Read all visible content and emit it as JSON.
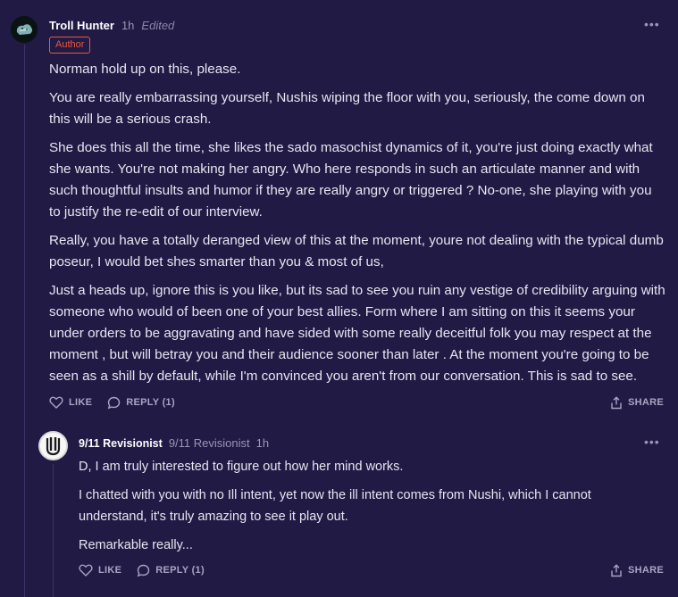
{
  "comment": {
    "author": "Troll Hunter",
    "time": "1h",
    "edited": "Edited",
    "badge": "Author",
    "paragraphs": [
      "Norman hold up on this, please.",
      "You are really embarrassing yourself, Nushis wiping the floor with you, seriously, the come down on this will be a serious crash.",
      "She does this all the time, she likes the sado masochist dynamics of it, you're just doing exactly what she wants. You're not making her angry. Who here responds in such an articulate manner and with such thoughtful insults and humor if they are really angry or triggered ? No-one, she playing with you to justify the re-edit of our interview.",
      "Really, you have a totally deranged view of this at the moment, youre not dealing with the typical dumb poseur, I would bet shes smarter than you & most of us,",
      "Just a heads up, ignore this is you like, but its sad to see you ruin any vestige of credibility arguing with someone who would of been one of your best allies. Form where I am sitting on this it seems your under orders to be aggravating and have sided with some really deceitful folk you may respect at the moment , but will betray you and their audience sooner than later . At the moment you're going to be seen as a shill by default, while I'm convinced you aren't from our conversation. This is sad to see."
    ],
    "like_label": "LIKE",
    "reply_label": "REPLY (1)",
    "share_label": "SHARE",
    "more_icon": "more-horizontal-icon"
  },
  "reply": {
    "author": "9/11 Revisionist",
    "handle": "9/11 Revisionist",
    "time": "1h",
    "paragraphs": [
      "D, I am truly interested to figure out how her mind works.",
      "I chatted with you with no Ill intent, yet now the ill intent comes from Nushi, which I cannot understand, it's truly amazing to see it play out.",
      "Remarkable really..."
    ],
    "like_label": "LIKE",
    "reply_label": "REPLY (1)",
    "share_label": "SHARE"
  },
  "colors": {
    "background": "#201a45",
    "badge": "#f0573a",
    "text": "#e7e5ef",
    "muted": "#9a96b3"
  }
}
